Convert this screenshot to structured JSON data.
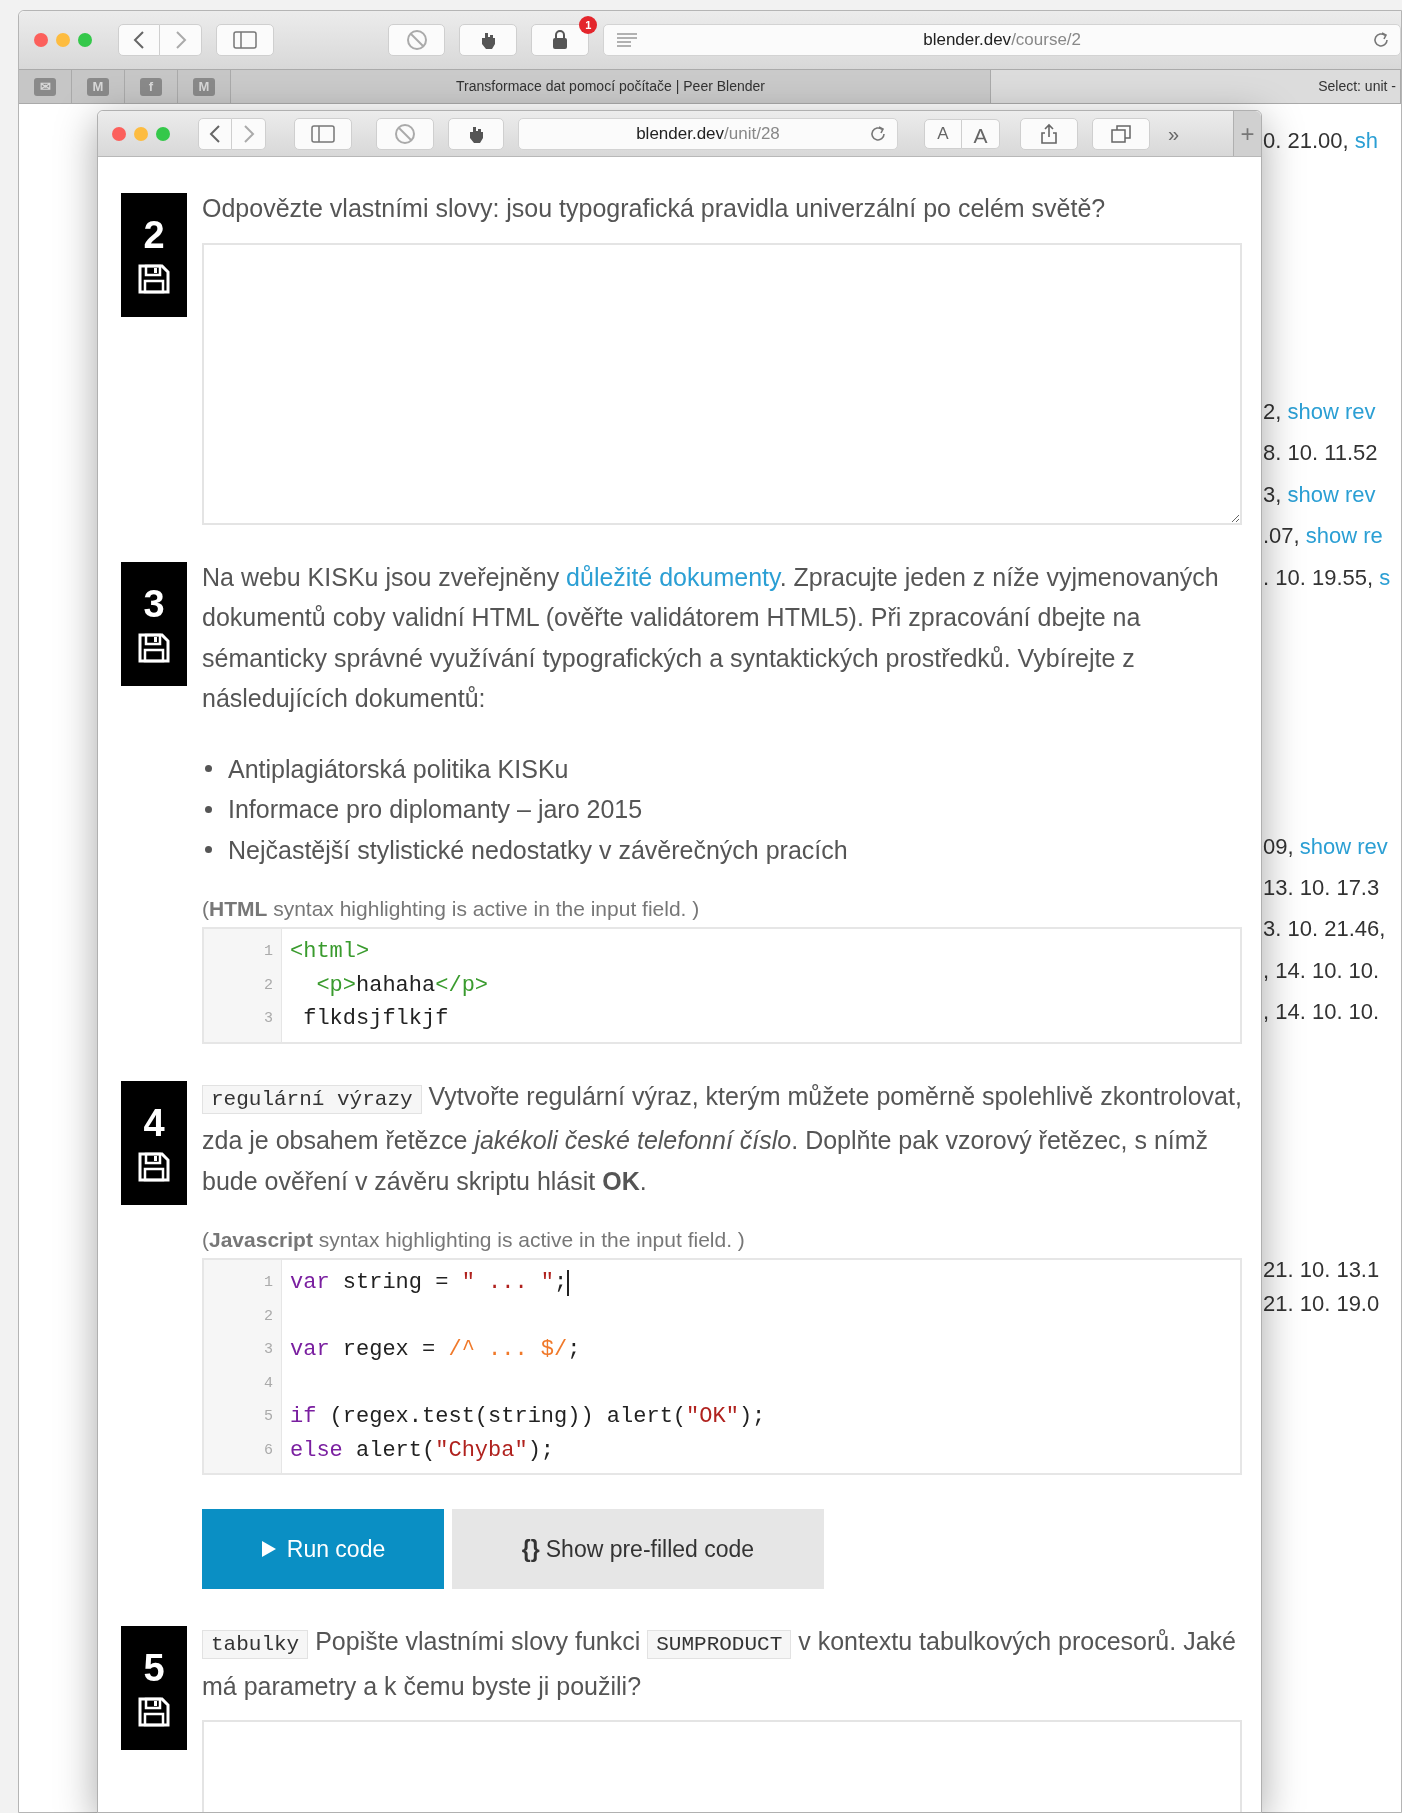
{
  "back_window": {
    "toolbar": {
      "notification_badge": "1",
      "url": {
        "domain": "blender.dev",
        "path": "/course/2"
      }
    },
    "tabs": [
      {
        "kind": "favicon",
        "label": "✉",
        "selected": false
      },
      {
        "kind": "favicon",
        "label": "M",
        "selected": false
      },
      {
        "kind": "favicon",
        "label": "f",
        "selected": false
      },
      {
        "kind": "favicon",
        "label": "M",
        "selected": false
      },
      {
        "kind": "page",
        "label": "Transformace dat pomocí počítače | Peer Blender",
        "selected": false
      },
      {
        "kind": "page",
        "label": "Select: unit -",
        "selected": true
      }
    ],
    "side_lines": [
      [
        {
          "kind": "plain",
          "text": "0. 21.00, "
        },
        {
          "kind": "link",
          "text": "sh"
        }
      ],
      [
        {
          "kind": "plain",
          "text": "2, "
        },
        {
          "kind": "link",
          "text": "show rev"
        }
      ],
      [
        {
          "kind": "plain",
          "text": "8. 10. 11.52"
        }
      ],
      [
        {
          "kind": "plain",
          "text": "3, "
        },
        {
          "kind": "link",
          "text": "show rev"
        }
      ],
      [
        {
          "kind": "plain",
          "text": ".07, "
        },
        {
          "kind": "link",
          "text": "show re"
        }
      ],
      [
        {
          "kind": "plain",
          "text": ". 10. 19.55, "
        },
        {
          "kind": "link",
          "text": "s"
        }
      ],
      [
        {
          "kind": "plain",
          "text": "09, "
        },
        {
          "kind": "link",
          "text": "show rev"
        }
      ],
      [
        {
          "kind": "plain",
          "text": "13. 10. 17.3"
        }
      ],
      [
        {
          "kind": "plain",
          "text": "3. 10. 21.46,"
        }
      ],
      [
        {
          "kind": "plain",
          "text": ", 14. 10. 10."
        }
      ],
      [
        {
          "kind": "plain",
          "text": ", 14. 10. 10."
        }
      ],
      [
        {
          "kind": "plain",
          "text": "21. 10. 13.1"
        }
      ],
      [
        {
          "kind": "plain",
          "text": "21. 10. 19.0"
        }
      ]
    ]
  },
  "front_window": {
    "url": {
      "domain": "blender.dev",
      "path": "/unit/28"
    },
    "text_size_buttons": [
      "A",
      "A"
    ],
    "overflow": "»",
    "new_tab": "+"
  },
  "questions": [
    {
      "number": "2",
      "prompt": [
        {
          "kind": "plain",
          "text": "Odpovězte vlastními slovy: jsou typografická pravidla univerzální po celém světě?"
        }
      ],
      "answer": {
        "kind": "textarea"
      }
    },
    {
      "number": "3",
      "prompt": [
        {
          "kind": "plain",
          "text": "Na webu KISKu jsou zveřejněny "
        },
        {
          "kind": "link",
          "text": "důležité dokumenty"
        },
        {
          "kind": "plain",
          "text": ". Zpracujte jeden z níže vyjmenovaných dokumentů coby validní HTML (ověřte validátorem HTML5). Při zpracování dbejte na sémanticky správné využívání typografických a syntaktických prostředků. Vybírejte z následujících dokumentů:"
        }
      ],
      "bullets": [
        "Antiplagiátorská politika KISKu",
        "Informace pro diplomanty – jaro 2015",
        "Nejčastější stylistické nedostatky v závěrečných pracích"
      ],
      "answer": {
        "kind": "editor",
        "hint": "(**HTML** syntax highlighting is active in the input field. )",
        "lines": [
          {
            "number": "1",
            "cursor": false,
            "tokens": [
              {
                "kind": "tag",
                "text": "<html>"
              }
            ]
          },
          {
            "number": "2",
            "cursor": false,
            "tokens": [
              {
                "kind": "tag",
                "text": "  <p>"
              },
              {
                "kind": "plain",
                "text": "hahaha"
              },
              {
                "kind": "tag",
                "text": "</p>"
              }
            ]
          },
          {
            "number": "3",
            "cursor": false,
            "tokens": [
              {
                "kind": "plain",
                "text": " flkdsjflkjf"
              }
            ]
          }
        ]
      }
    },
    {
      "number": "4",
      "prompt": [
        {
          "kind": "code",
          "text": "regulární výrazy"
        },
        {
          "kind": "plain",
          "text": " Vytvořte regulární výraz, kterým můžete poměrně spolehlivě zkontrolovat, zda je obsahem řetězce *jakékoli české telefonní číslo*. Doplňte pak vzorový řetězec, s nímž bude ověření v závěru skriptu hlásit **OK**."
        }
      ],
      "answer": {
        "kind": "editor",
        "hint": "(**Javascript** syntax highlighting is active in the input field. )",
        "lines": [
          {
            "number": "1",
            "cursor": true,
            "tokens": [
              {
                "kind": "keyword",
                "text": "var"
              },
              {
                "kind": "plain",
                "text": " string = "
              },
              {
                "kind": "string",
                "text": "\" ... \""
              },
              {
                "kind": "plain",
                "text": ";"
              }
            ]
          },
          {
            "number": "2",
            "cursor": false
          },
          {
            "number": "3",
            "cursor": false,
            "tokens": [
              {
                "kind": "keyword",
                "text": "var"
              },
              {
                "kind": "plain",
                "text": " regex = "
              },
              {
                "kind": "regex",
                "text": "/^ ... $/"
              },
              {
                "kind": "plain",
                "text": ";"
              }
            ]
          },
          {
            "number": "4",
            "cursor": false
          },
          {
            "number": "5",
            "cursor": false,
            "tokens": [
              {
                "kind": "keyword",
                "text": "if"
              },
              {
                "kind": "plain",
                "text": " (regex.test(string)) alert("
              },
              {
                "kind": "string",
                "text": "\"OK\""
              },
              {
                "kind": "plain",
                "text": ");"
              }
            ]
          },
          {
            "number": "6",
            "cursor": false,
            "tokens": [
              {
                "kind": "keyword",
                "text": "else"
              },
              {
                "kind": "plain",
                "text": " alert("
              },
              {
                "kind": "string",
                "text": "\"Chyba\""
              },
              {
                "kind": "plain",
                "text": ");"
              }
            ]
          }
        ],
        "actions": [
          {
            "kind": "run",
            "label": "Run code"
          },
          {
            "kind": "prefill",
            "glyph": "{}",
            "label": "Show pre-filled code"
          }
        ]
      }
    },
    {
      "number": "5",
      "prompt": [
        {
          "kind": "code",
          "text": "tabulky"
        },
        {
          "kind": "plain",
          "text": " Popište vlastními slovy funkci "
        },
        {
          "kind": "code",
          "text": "SUMPRODUCT"
        },
        {
          "kind": "plain",
          "text": " v kontextu tabulkových procesorů. Jaké má parametry a k čemu byste ji použili?"
        }
      ],
      "answer": {
        "kind": "textarea"
      }
    }
  ]
}
